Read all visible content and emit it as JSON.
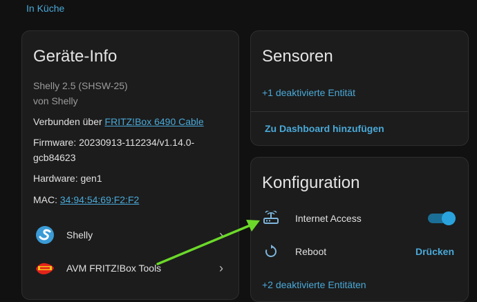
{
  "area_link": "In Küche",
  "device_info": {
    "title": "Geräte-Info",
    "model": "Shelly 2.5 (SHSW-25)",
    "manufacturer": "von Shelly",
    "connected_prefix": "Verbunden über ",
    "connected_link": "FRITZ!Box 6490 Cable",
    "firmware_line1": "Firmware: 20230913-112234/v1.14.0-",
    "firmware_line2": "gcb84623",
    "hardware": "Hardware: gen1",
    "mac_prefix": "MAC: ",
    "mac_link": "34:94:54:69:F2:F2",
    "integrations": [
      {
        "label": "Shelly",
        "icon": "shelly-icon"
      },
      {
        "label": "AVM FRITZ!Box Tools",
        "icon": "fritzbox-icon"
      }
    ]
  },
  "sensors": {
    "title": "Sensoren",
    "disabled_entities": "+1 deaktivierte Entität",
    "add_dashboard": "Zu Dashboard hinzufügen"
  },
  "configuration": {
    "title": "Konfiguration",
    "items": [
      {
        "label": "Internet Access",
        "icon": "router-network-icon",
        "control": "toggle",
        "state": "on"
      },
      {
        "label": "Reboot",
        "icon": "restart-icon",
        "control": "button",
        "button_label": "Drücken"
      }
    ],
    "disabled_entities": "+2 deaktivierte Entitäten"
  },
  "colors": {
    "accent": "#4aa9d8",
    "background": "#111111",
    "card": "#1c1c1c",
    "annotation_arrow": "#6cd92a"
  }
}
